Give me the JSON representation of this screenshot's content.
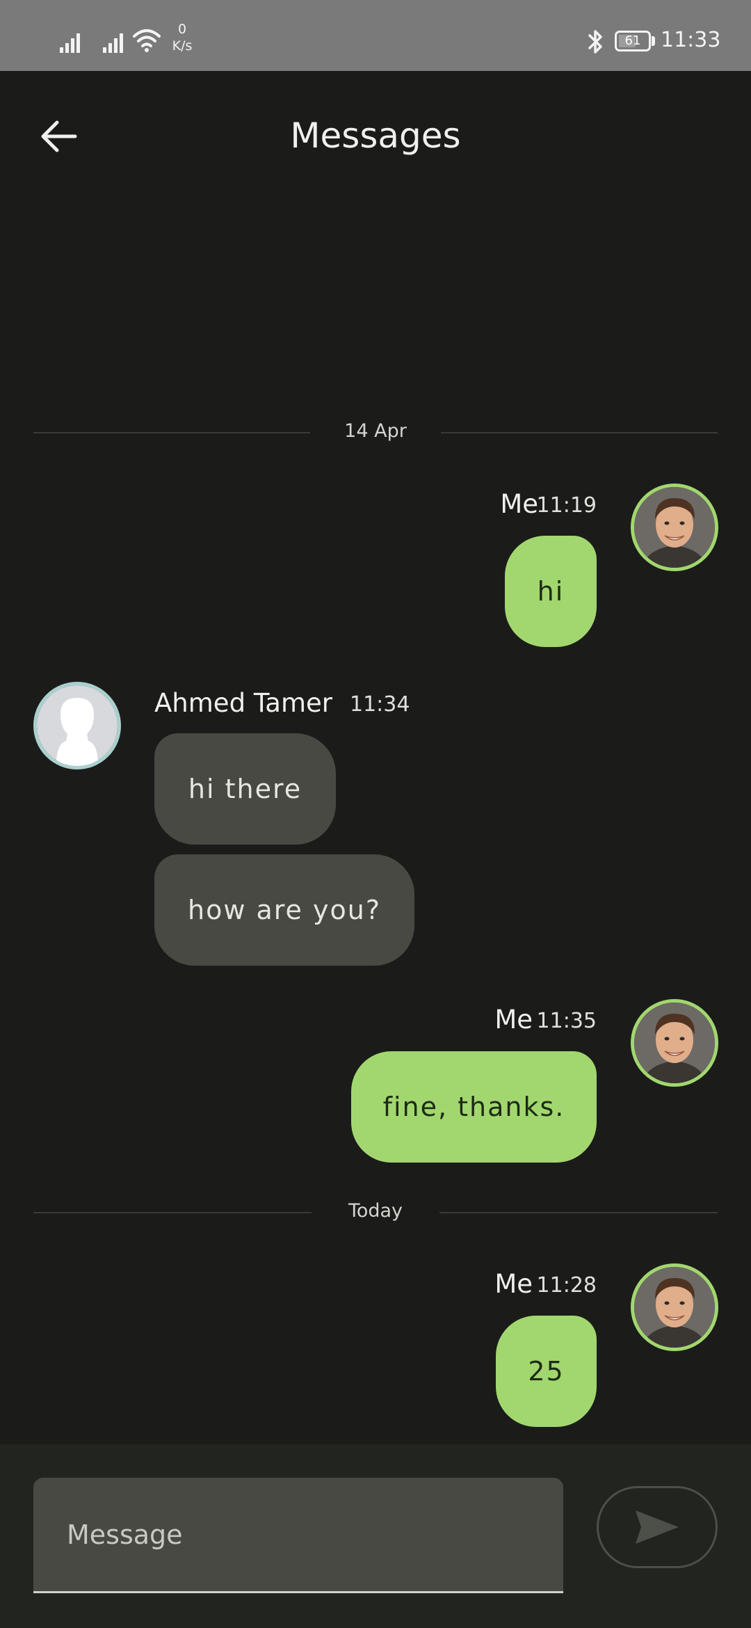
{
  "status_bar": {
    "net_speed_value": "0",
    "net_speed_unit": "K/s",
    "battery_level": "61",
    "battery_fraction": 0.61,
    "time": "11:33",
    "icons": [
      "signal-icon",
      "signal-icon",
      "wifi-icon",
      "bluetooth-icon",
      "battery-icon"
    ]
  },
  "header": {
    "title": "Messages",
    "back_icon": "back-arrow-icon"
  },
  "separators": {
    "first": "14 Apr",
    "second": "Today"
  },
  "messages": [
    {
      "sender": "Me",
      "time": "11:19",
      "text": "hi",
      "direction": "outgoing"
    },
    {
      "sender": "Ahmed Tamer",
      "time": "11:34",
      "texts": [
        "hi there",
        "how are you?"
      ],
      "direction": "incoming"
    },
    {
      "sender": "Me",
      "time": "11:35",
      "text": "fine, thanks.",
      "direction": "outgoing"
    },
    {
      "sender": "Me",
      "time": "11:28",
      "text": "25",
      "direction": "outgoing"
    }
  ],
  "composer": {
    "placeholder": "Message",
    "value": "",
    "send_icon": "send-icon"
  },
  "colors": {
    "background": "#1b1c19",
    "outgoing_bubble": "#a2d76f",
    "incoming_bubble": "#484943",
    "status_bar": "#7a7a7a",
    "my_avatar_ring": "#a2d76f",
    "contact_avatar_ring": "#a9d0cf"
  }
}
